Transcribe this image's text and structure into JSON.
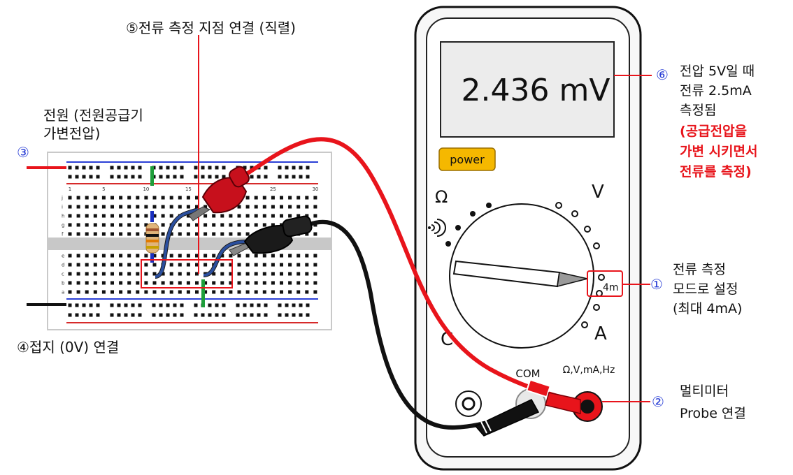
{
  "labels": {
    "l5": "⑤전류 측정 지점 연결 (직렬)",
    "l3_num": "③",
    "l3_text_1": "전원 (전원공급기",
    "l3_text_2": "가변전압)",
    "l4": "④접지 (0V) 연결",
    "l6_num": "⑥",
    "l6_text_1": "전압 5V일 때",
    "l6_text_2": "전류 2.5mA",
    "l6_text_3": "측정됨",
    "l6_red_1": "(공급전압을",
    "l6_red_2": "가변 시키면서",
    "l6_red_3": "전류를 측정)",
    "l1_num": "①",
    "l1_text_1": "전류 측정",
    "l1_text_2": "모드로 설정",
    "l1_text_3": "(최대 4mA)",
    "l2_num": "②",
    "l2_text_1": "멀티미터",
    "l2_text_2": "Probe 연결"
  },
  "multimeter": {
    "display_value": "2.436 mV",
    "power_label": "power",
    "dial_ohm": "Ω",
    "dial_v": "V",
    "dial_c": "C",
    "dial_a": "A",
    "dial_4m": "4m",
    "port_com": "COM",
    "port_main": "Ω,V,mA,Hz"
  },
  "breadboard": {
    "col_numbers": [
      "1",
      "5",
      "10",
      "15",
      "20",
      "25",
      "30"
    ],
    "row_letters_top": [
      "j",
      "i",
      "h",
      "g",
      "f"
    ],
    "row_letters_bottom": [
      "e",
      "d",
      "c",
      "b",
      "a"
    ]
  },
  "colors": {
    "red_probe": "#e8141b",
    "black_probe": "#111111",
    "blue_wire": "#2b4f9e",
    "green_wire": "#1e9e3a",
    "power_btn": "#f5b800"
  }
}
